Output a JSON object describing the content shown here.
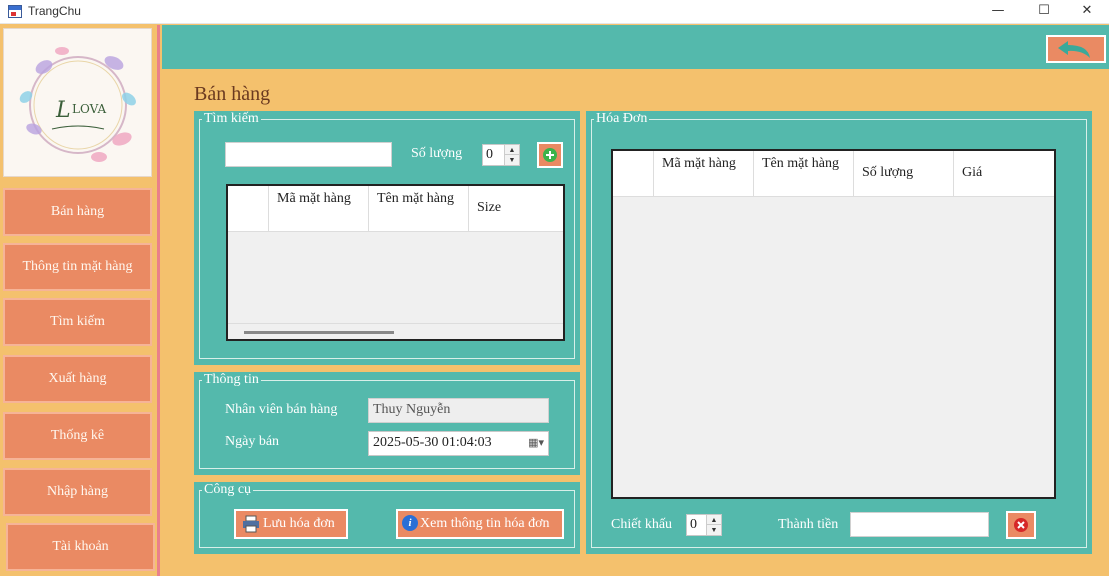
{
  "window": {
    "title": "TrangChu",
    "min_icon": "minimize-icon",
    "max_icon": "maximize-icon",
    "close_icon": "close-icon"
  },
  "sidebar": {
    "logo_text": "LOVA",
    "items": [
      {
        "label": "Bán hàng"
      },
      {
        "label": "Thông tin mặt hàng"
      },
      {
        "label": "Tìm kiếm"
      },
      {
        "label": "Xuất hàng"
      },
      {
        "label": "Thống kê"
      },
      {
        "label": "Nhập hàng"
      },
      {
        "label": "Tài khoản"
      }
    ]
  },
  "header": {
    "back_icon": "back-arrow-icon"
  },
  "page": {
    "title": "Bán hàng"
  },
  "search_group": {
    "legend": "Tìm kiếm",
    "search_value": "",
    "qty_label": "Số lượng",
    "qty_value": "0",
    "add_icon": "plus-icon",
    "columns": [
      "Mã mặt hàng",
      "Tên mặt hàng",
      "Size"
    ]
  },
  "info_group": {
    "legend": "Thông tin",
    "employee_label": "Nhân viên bán hàng",
    "employee_value": "Thuy Nguyễn",
    "date_label": "Ngày bán",
    "date_value": "2025-05-30 01:04:03"
  },
  "tools_group": {
    "legend": "Công cụ",
    "save_label": "Lưu hóa đơn",
    "view_label": "Xem thông tin hóa đơn"
  },
  "invoice_group": {
    "legend": "Hóa Đơn",
    "columns": [
      "Mã mặt hàng",
      "Tên mặt hàng",
      "Số lượng",
      "Giá"
    ],
    "discount_label": "Chiết khấu",
    "discount_value": "0",
    "total_label": "Thành tiền",
    "total_value": "",
    "delete_icon": "delete-icon"
  },
  "colors": {
    "accent": "#54b9ac",
    "button": "#ea8a63",
    "background": "#f4c16d",
    "title": "#6b3a20"
  }
}
